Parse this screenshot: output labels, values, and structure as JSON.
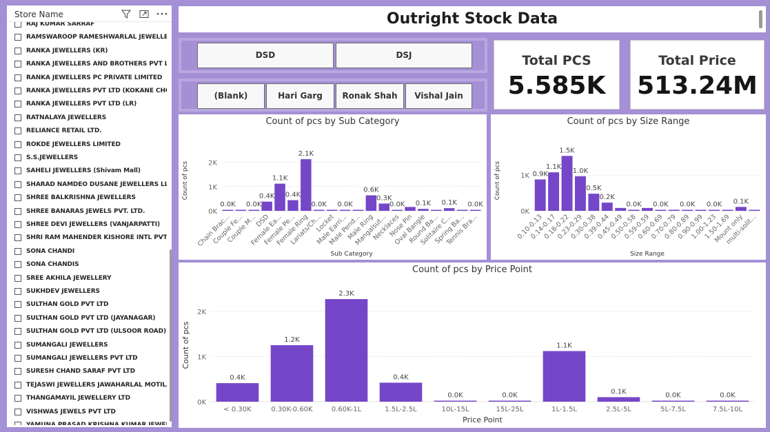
{
  "slicer": {
    "title": "Store Name",
    "items": [
      "RAJ KUMAR SARRAF",
      "RAMSWAROOP RAMESHWARLAL JEWELLER",
      "RANKA JEWELLERS (KR)",
      "RANKA JEWELLERS AND BROTHERS PVT LTD",
      "RANKA JEWELLERS PC PRIVATE LIMITED",
      "RANKA JEWELLERS PVT LTD (KOKANE CHO...",
      "RANKA JEWELLERS PVT LTD (LR)",
      "RATNALAYA JEWELLERS",
      "RELIANCE RETAIL LTD.",
      "ROKDE JEWELLERS LIMITED",
      "S.S.JEWELLERS",
      "SAHELI JEWELLERS (Shivam Mall)",
      "SHARAD NAMDEO DUSANE JEWELLERS LLP",
      "SHREE BALKRISHNA JEWELLERS",
      "SHREE BANARAS JEWELS PVT. LTD.",
      "SHREE DEVI JEWELLERS (VANJARPATTI)",
      "SHRI RAM MAHENDER KISHORE INTL PVT LT...",
      "SONA CHANDI",
      "SONA CHANDIS",
      "SREE AKHILA JEWELLERY",
      "SUKHDEV JEWELLERS",
      "SULTHAN GOLD PVT LTD",
      "SULTHAN GOLD PVT LTD (JAYANAGAR)",
      "SULTHAN GOLD PVT LTD (ULSOOR ROAD)",
      "SUMANGALI JEWELLERS",
      "SUMANGALI JEWELLERS PVT LTD",
      "SURESH CHAND SARAF PVT LTD",
      "TEJASWI JEWELLERS JAWAHARLAL MOTILAL...",
      "THANGAMAYIL JEWELLERY LTD",
      "VISHWAS JEWELS PVT LTD",
      "YAMUNA PRASAD KRISHNA KUMAR JEWELL..."
    ]
  },
  "header": {
    "title": "Outright Stock Data"
  },
  "filters": {
    "store_type": [
      "DSD",
      "DSJ"
    ],
    "persons": [
      "(Blank)",
      "Hari Garg",
      "Ronak Shah",
      "Vishal Jain"
    ]
  },
  "kpis": {
    "total_pcs": {
      "label": "Total PCS",
      "value": "5.585K"
    },
    "total_price": {
      "label": "Total Price",
      "value": "513.24M"
    }
  },
  "colors": {
    "bar": "#7546c8",
    "grid": "#e3e3e3",
    "axis_text": "#666666"
  },
  "chart_data": [
    {
      "type": "bar",
      "title": "Count of pcs by Sub Category",
      "xlabel": "Sub Category",
      "ylabel": "Count of pcs",
      "ylim": [
        0,
        2500
      ],
      "yticks": [
        0,
        1000,
        2000
      ],
      "yticklabels": [
        "0K",
        "1K",
        "2K"
      ],
      "categories": [
        "Chain Brac...",
        "Couple Fe...",
        "Couple M...",
        "DSD",
        "Female Ea...",
        "Female Pe...",
        "Female Ring",
        "Lariats/Ch...",
        "Locket",
        "Male Earri...",
        "Male Pend...",
        "Male Ring",
        "Mangalsut...",
        "Necklaces",
        "Nose Pin",
        "Oval Bangle",
        "Round Ba...",
        "Solitaire C...",
        "Spring Ba...",
        "Tennis Bra..."
      ],
      "values": [
        10,
        20,
        30,
        380,
        1120,
        440,
        2130,
        20,
        30,
        20,
        30,
        640,
        300,
        30,
        160,
        80,
        40,
        110,
        40,
        20
      ],
      "data_labels": [
        "0.0K",
        "",
        "0.0K",
        "0.4K",
        "1.1K",
        "0.4K",
        "2.1K",
        "0.0K",
        "",
        "0.0K",
        "",
        "0.6K",
        "0.3K",
        "0.0K",
        "",
        "0.1K",
        "",
        "0.1K",
        "",
        "0.0K"
      ]
    },
    {
      "type": "bar",
      "title": "Count of pcs by Size Range",
      "xlabel": "Size Range",
      "ylabel": "Count of pcs",
      "ylim": [
        0,
        1700
      ],
      "yticks": [
        0,
        1000
      ],
      "yticklabels": [
        "0K",
        "1K"
      ],
      "categories": [
        "0.10-0.13",
        "0.14-0.17",
        "0.18-0.22",
        "0.23-0.29",
        "0.30-0.38",
        "0.39-0.44",
        "0.45-0.49",
        "0.50-0.58",
        "0.59-0.59",
        "0.60-0.69",
        "0.70-0.79",
        "0.80-0.89",
        "0.90-0.99",
        "1.00-1.23",
        "1.50-1.69",
        "Mount only",
        "multi-solit..."
      ],
      "values": [
        880,
        1080,
        1540,
        970,
        480,
        230,
        80,
        30,
        80,
        20,
        30,
        10,
        20,
        10,
        20,
        110,
        10
      ],
      "data_labels": [
        "0.9K",
        "1.1K",
        "1.5K",
        "1.0K",
        "0.5K",
        "0.2K",
        "",
        "0.0K",
        "",
        "0.0K",
        "",
        "0.0K",
        "",
        "0.0K",
        "",
        "0.1K",
        ""
      ]
    },
    {
      "type": "bar",
      "title": "Count of pcs by Price Point",
      "xlabel": "Price Point",
      "ylabel": "Count of pcs",
      "ylim": [
        0,
        2500
      ],
      "yticks": [
        0,
        1000,
        2000
      ],
      "yticklabels": [
        "0K",
        "1K",
        "2K"
      ],
      "categories": [
        "< 0.30K",
        "0.30K-0.60K",
        "0.60K-1L",
        "1.5L-2.5L",
        "10L-15L",
        "15L-25L",
        "1L-1.5L",
        "2.5L-5L",
        "5L-7.5L",
        "7.5L-10L"
      ],
      "values": [
        410,
        1250,
        2270,
        420,
        20,
        20,
        1120,
        100,
        20,
        10
      ],
      "data_labels": [
        "0.4K",
        "1.2K",
        "2.3K",
        "0.4K",
        "0.0K",
        "0.0K",
        "1.1K",
        "0.1K",
        "0.0K",
        "0.0K"
      ]
    }
  ]
}
